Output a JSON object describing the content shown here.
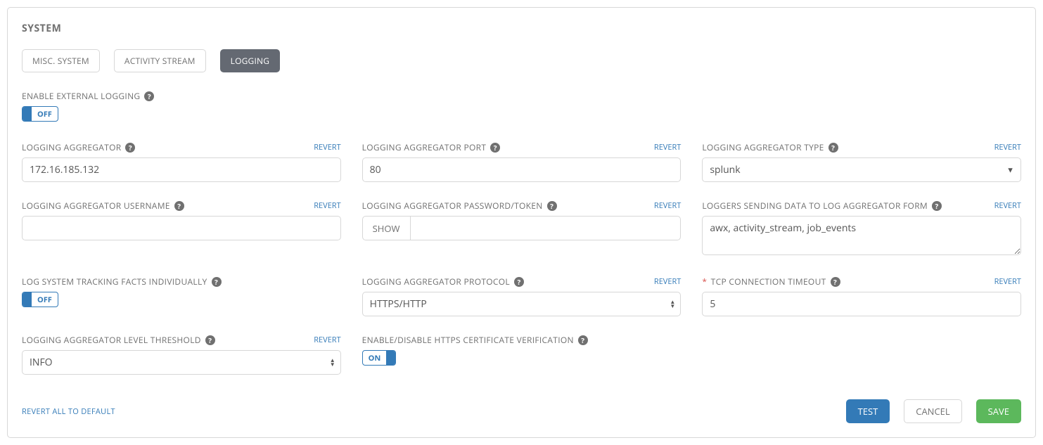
{
  "panel": {
    "title": "SYSTEM"
  },
  "tabs": {
    "misc": "MISC. SYSTEM",
    "activity": "ACTIVITY STREAM",
    "logging": "LOGGING"
  },
  "labels": {
    "enable_ext": "ENABLE EXTERNAL LOGGING",
    "aggregator": "LOGGING AGGREGATOR",
    "port": "LOGGING AGGREGATOR PORT",
    "type": "LOGGING AGGREGATOR TYPE",
    "username": "LOGGING AGGREGATOR USERNAME",
    "password": "LOGGING AGGREGATOR PASSWORD/TOKEN",
    "loggers": "LOGGERS SENDING DATA TO LOG AGGREGATOR FORM",
    "tracking": "LOG SYSTEM TRACKING FACTS INDIVIDUALLY",
    "protocol": "LOGGING AGGREGATOR PROTOCOL",
    "timeout": "TCP CONNECTION TIMEOUT",
    "level": "LOGGING AGGREGATOR LEVEL THRESHOLD",
    "cert": "ENABLE/DISABLE HTTPS CERTIFICATE VERIFICATION"
  },
  "values": {
    "enable_ext": "OFF",
    "aggregator": "172.16.185.132",
    "port": "80",
    "type": "splunk",
    "username": "",
    "password": "",
    "loggers": "awx, activity_stream, job_events",
    "tracking": "OFF",
    "protocol": "HTTPS/HTTP",
    "timeout": "5",
    "level": "INFO",
    "cert": "ON"
  },
  "actions": {
    "revert": "REVERT",
    "show": "SHOW",
    "revert_all": "REVERT ALL TO DEFAULT",
    "test": "TEST",
    "cancel": "CANCEL",
    "save": "SAVE"
  },
  "required_marker": "*"
}
